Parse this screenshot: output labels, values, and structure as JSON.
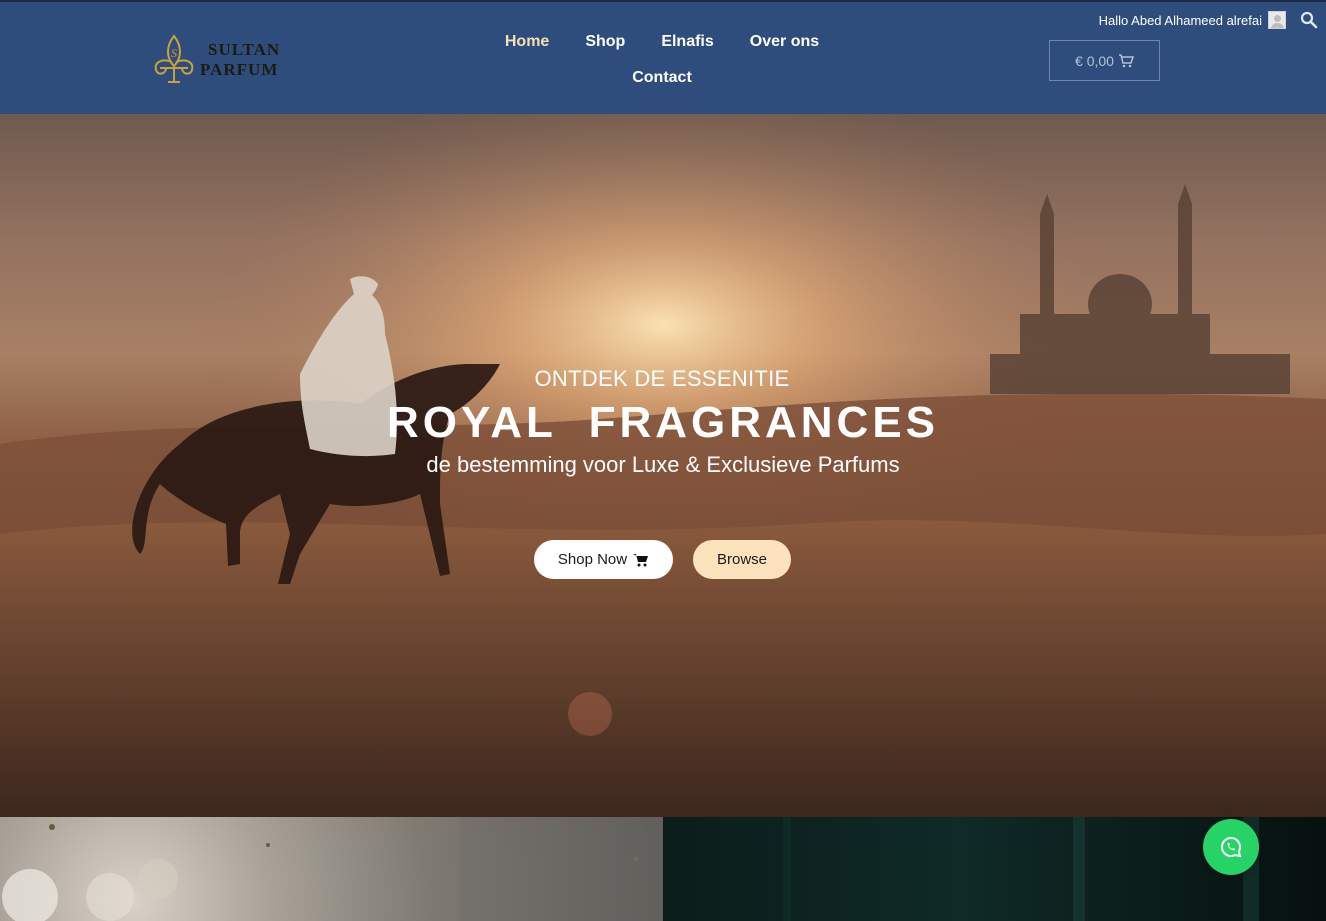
{
  "brand": {
    "name_line1": "SULTAN",
    "name_line2": "PARFUM",
    "logo_icon": "fleur-de-lis-logo",
    "colors": {
      "header": "#2e4d7d",
      "gold": "#c9a23a",
      "accent": "#f7dfb2"
    }
  },
  "nav": {
    "items": [
      {
        "label": "Home",
        "active": true
      },
      {
        "label": "Shop"
      },
      {
        "label": "Elnafis"
      },
      {
        "label": "Over ons"
      },
      {
        "label": "Contact"
      }
    ]
  },
  "user": {
    "greeting": "Hallo Abed Alhameed alrefai",
    "avatar_icon": "user-avatar-icon",
    "search_icon": "search-icon"
  },
  "cart": {
    "amount": "€ 0,00",
    "icon": "cart-icon"
  },
  "hero": {
    "kicker": "ONTDEK DE ESSENITIE",
    "title": "ROYAL  FRAGRANCES",
    "subtitle": "de bestemming voor Luxe & Exclusieve Parfums",
    "shop_now_label": "Shop Now",
    "browse_label": "Browse"
  },
  "floating": {
    "whatsapp_icon": "whatsapp-icon",
    "color": "#25d366"
  }
}
